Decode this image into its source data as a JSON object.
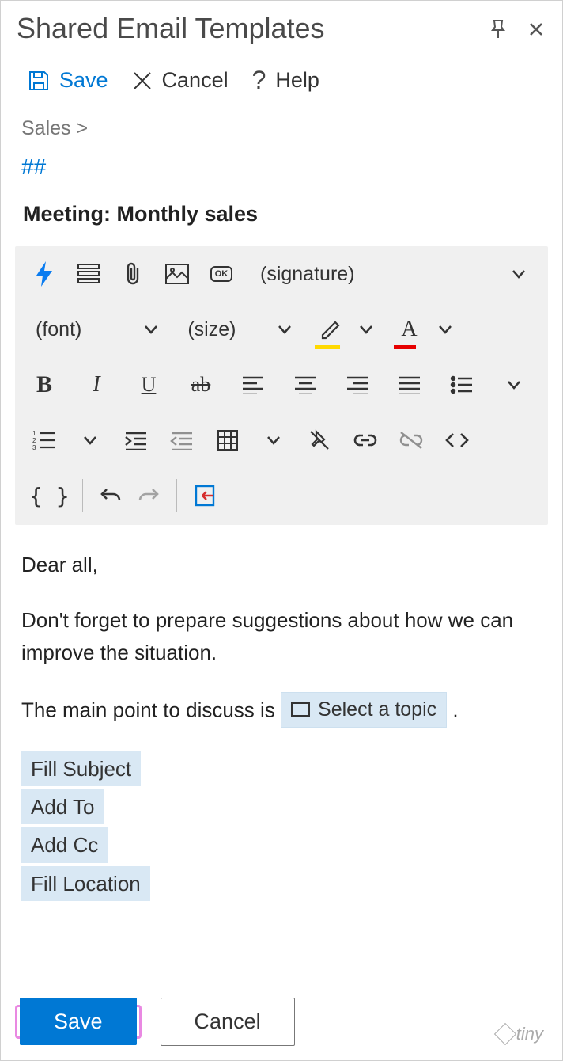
{
  "title": "Shared Email Templates",
  "menu": {
    "save": "Save",
    "cancel": "Cancel",
    "help": "Help"
  },
  "breadcrumb": "Sales  >",
  "hash": "##",
  "subject": "Meeting: Monthly sales",
  "toolbar": {
    "signature": "(signature)",
    "font": "(font)",
    "size": "(size)",
    "bold": "B",
    "italic": "I",
    "underline": "U",
    "strike": "ab",
    "textcolor": "A",
    "braces": "{ }",
    "ok": "OK"
  },
  "body": {
    "greeting": "Dear all,",
    "para1": "Don't forget to prepare suggestions about how we can improve the situation.",
    "para2a": "The main point to discuss is ",
    "topic_chip": "Select a topic",
    "para2b": " ."
  },
  "macros": [
    "Fill Subject",
    "Add To",
    "Add Cc",
    "Fill Location"
  ],
  "footer": {
    "save": "Save",
    "cancel": "Cancel",
    "tiny": "tiny"
  }
}
